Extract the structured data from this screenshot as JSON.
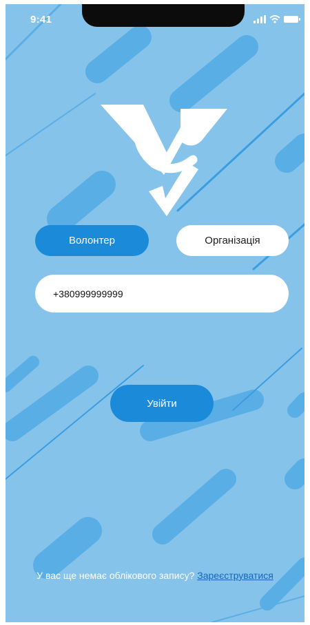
{
  "status_bar": {
    "time": "9:41",
    "icons": [
      "signal-icon",
      "wifi-icon",
      "battery-icon"
    ]
  },
  "logo": {
    "name": "app-logo"
  },
  "role_selector": {
    "volunteer_label": "Волонтер",
    "organization_label": "Організація",
    "selected": "volunteer"
  },
  "phone_field": {
    "value": "+380999999999"
  },
  "login_button": {
    "label": "Увійти"
  },
  "signup": {
    "prompt": "У вас ще немає облікового запису?",
    "link": "Зареєструватися"
  },
  "colors": {
    "background": "#86c3eb",
    "accent": "#1b8bd9",
    "link": "#1565b8"
  }
}
